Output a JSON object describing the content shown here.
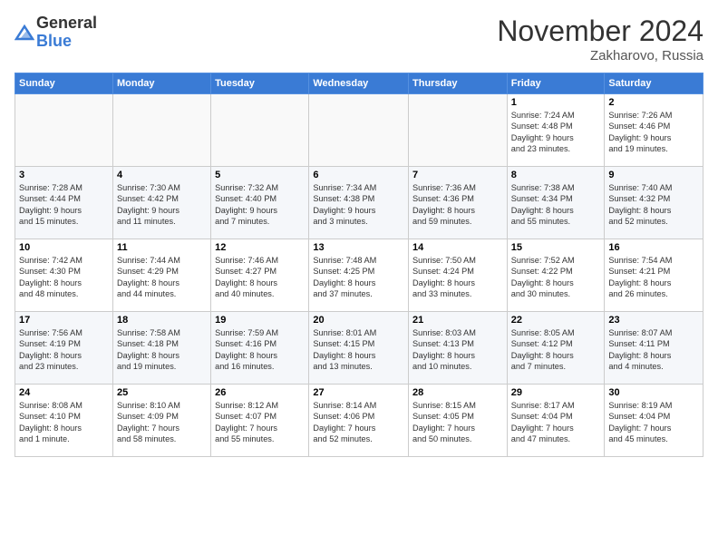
{
  "logo": {
    "general": "General",
    "blue": "Blue"
  },
  "header": {
    "month": "November 2024",
    "location": "Zakharovo, Russia"
  },
  "weekdays": [
    "Sunday",
    "Monday",
    "Tuesday",
    "Wednesday",
    "Thursday",
    "Friday",
    "Saturday"
  ],
  "weeks": [
    [
      {
        "day": "",
        "info": ""
      },
      {
        "day": "",
        "info": ""
      },
      {
        "day": "",
        "info": ""
      },
      {
        "day": "",
        "info": ""
      },
      {
        "day": "",
        "info": ""
      },
      {
        "day": "1",
        "info": "Sunrise: 7:24 AM\nSunset: 4:48 PM\nDaylight: 9 hours\nand 23 minutes."
      },
      {
        "day": "2",
        "info": "Sunrise: 7:26 AM\nSunset: 4:46 PM\nDaylight: 9 hours\nand 19 minutes."
      }
    ],
    [
      {
        "day": "3",
        "info": "Sunrise: 7:28 AM\nSunset: 4:44 PM\nDaylight: 9 hours\nand 15 minutes."
      },
      {
        "day": "4",
        "info": "Sunrise: 7:30 AM\nSunset: 4:42 PM\nDaylight: 9 hours\nand 11 minutes."
      },
      {
        "day": "5",
        "info": "Sunrise: 7:32 AM\nSunset: 4:40 PM\nDaylight: 9 hours\nand 7 minutes."
      },
      {
        "day": "6",
        "info": "Sunrise: 7:34 AM\nSunset: 4:38 PM\nDaylight: 9 hours\nand 3 minutes."
      },
      {
        "day": "7",
        "info": "Sunrise: 7:36 AM\nSunset: 4:36 PM\nDaylight: 8 hours\nand 59 minutes."
      },
      {
        "day": "8",
        "info": "Sunrise: 7:38 AM\nSunset: 4:34 PM\nDaylight: 8 hours\nand 55 minutes."
      },
      {
        "day": "9",
        "info": "Sunrise: 7:40 AM\nSunset: 4:32 PM\nDaylight: 8 hours\nand 52 minutes."
      }
    ],
    [
      {
        "day": "10",
        "info": "Sunrise: 7:42 AM\nSunset: 4:30 PM\nDaylight: 8 hours\nand 48 minutes."
      },
      {
        "day": "11",
        "info": "Sunrise: 7:44 AM\nSunset: 4:29 PM\nDaylight: 8 hours\nand 44 minutes."
      },
      {
        "day": "12",
        "info": "Sunrise: 7:46 AM\nSunset: 4:27 PM\nDaylight: 8 hours\nand 40 minutes."
      },
      {
        "day": "13",
        "info": "Sunrise: 7:48 AM\nSunset: 4:25 PM\nDaylight: 8 hours\nand 37 minutes."
      },
      {
        "day": "14",
        "info": "Sunrise: 7:50 AM\nSunset: 4:24 PM\nDaylight: 8 hours\nand 33 minutes."
      },
      {
        "day": "15",
        "info": "Sunrise: 7:52 AM\nSunset: 4:22 PM\nDaylight: 8 hours\nand 30 minutes."
      },
      {
        "day": "16",
        "info": "Sunrise: 7:54 AM\nSunset: 4:21 PM\nDaylight: 8 hours\nand 26 minutes."
      }
    ],
    [
      {
        "day": "17",
        "info": "Sunrise: 7:56 AM\nSunset: 4:19 PM\nDaylight: 8 hours\nand 23 minutes."
      },
      {
        "day": "18",
        "info": "Sunrise: 7:58 AM\nSunset: 4:18 PM\nDaylight: 8 hours\nand 19 minutes."
      },
      {
        "day": "19",
        "info": "Sunrise: 7:59 AM\nSunset: 4:16 PM\nDaylight: 8 hours\nand 16 minutes."
      },
      {
        "day": "20",
        "info": "Sunrise: 8:01 AM\nSunset: 4:15 PM\nDaylight: 8 hours\nand 13 minutes."
      },
      {
        "day": "21",
        "info": "Sunrise: 8:03 AM\nSunset: 4:13 PM\nDaylight: 8 hours\nand 10 minutes."
      },
      {
        "day": "22",
        "info": "Sunrise: 8:05 AM\nSunset: 4:12 PM\nDaylight: 8 hours\nand 7 minutes."
      },
      {
        "day": "23",
        "info": "Sunrise: 8:07 AM\nSunset: 4:11 PM\nDaylight: 8 hours\nand 4 minutes."
      }
    ],
    [
      {
        "day": "24",
        "info": "Sunrise: 8:08 AM\nSunset: 4:10 PM\nDaylight: 8 hours\nand 1 minute."
      },
      {
        "day": "25",
        "info": "Sunrise: 8:10 AM\nSunset: 4:09 PM\nDaylight: 7 hours\nand 58 minutes."
      },
      {
        "day": "26",
        "info": "Sunrise: 8:12 AM\nSunset: 4:07 PM\nDaylight: 7 hours\nand 55 minutes."
      },
      {
        "day": "27",
        "info": "Sunrise: 8:14 AM\nSunset: 4:06 PM\nDaylight: 7 hours\nand 52 minutes."
      },
      {
        "day": "28",
        "info": "Sunrise: 8:15 AM\nSunset: 4:05 PM\nDaylight: 7 hours\nand 50 minutes."
      },
      {
        "day": "29",
        "info": "Sunrise: 8:17 AM\nSunset: 4:04 PM\nDaylight: 7 hours\nand 47 minutes."
      },
      {
        "day": "30",
        "info": "Sunrise: 8:19 AM\nSunset: 4:04 PM\nDaylight: 7 hours\nand 45 minutes."
      }
    ]
  ]
}
